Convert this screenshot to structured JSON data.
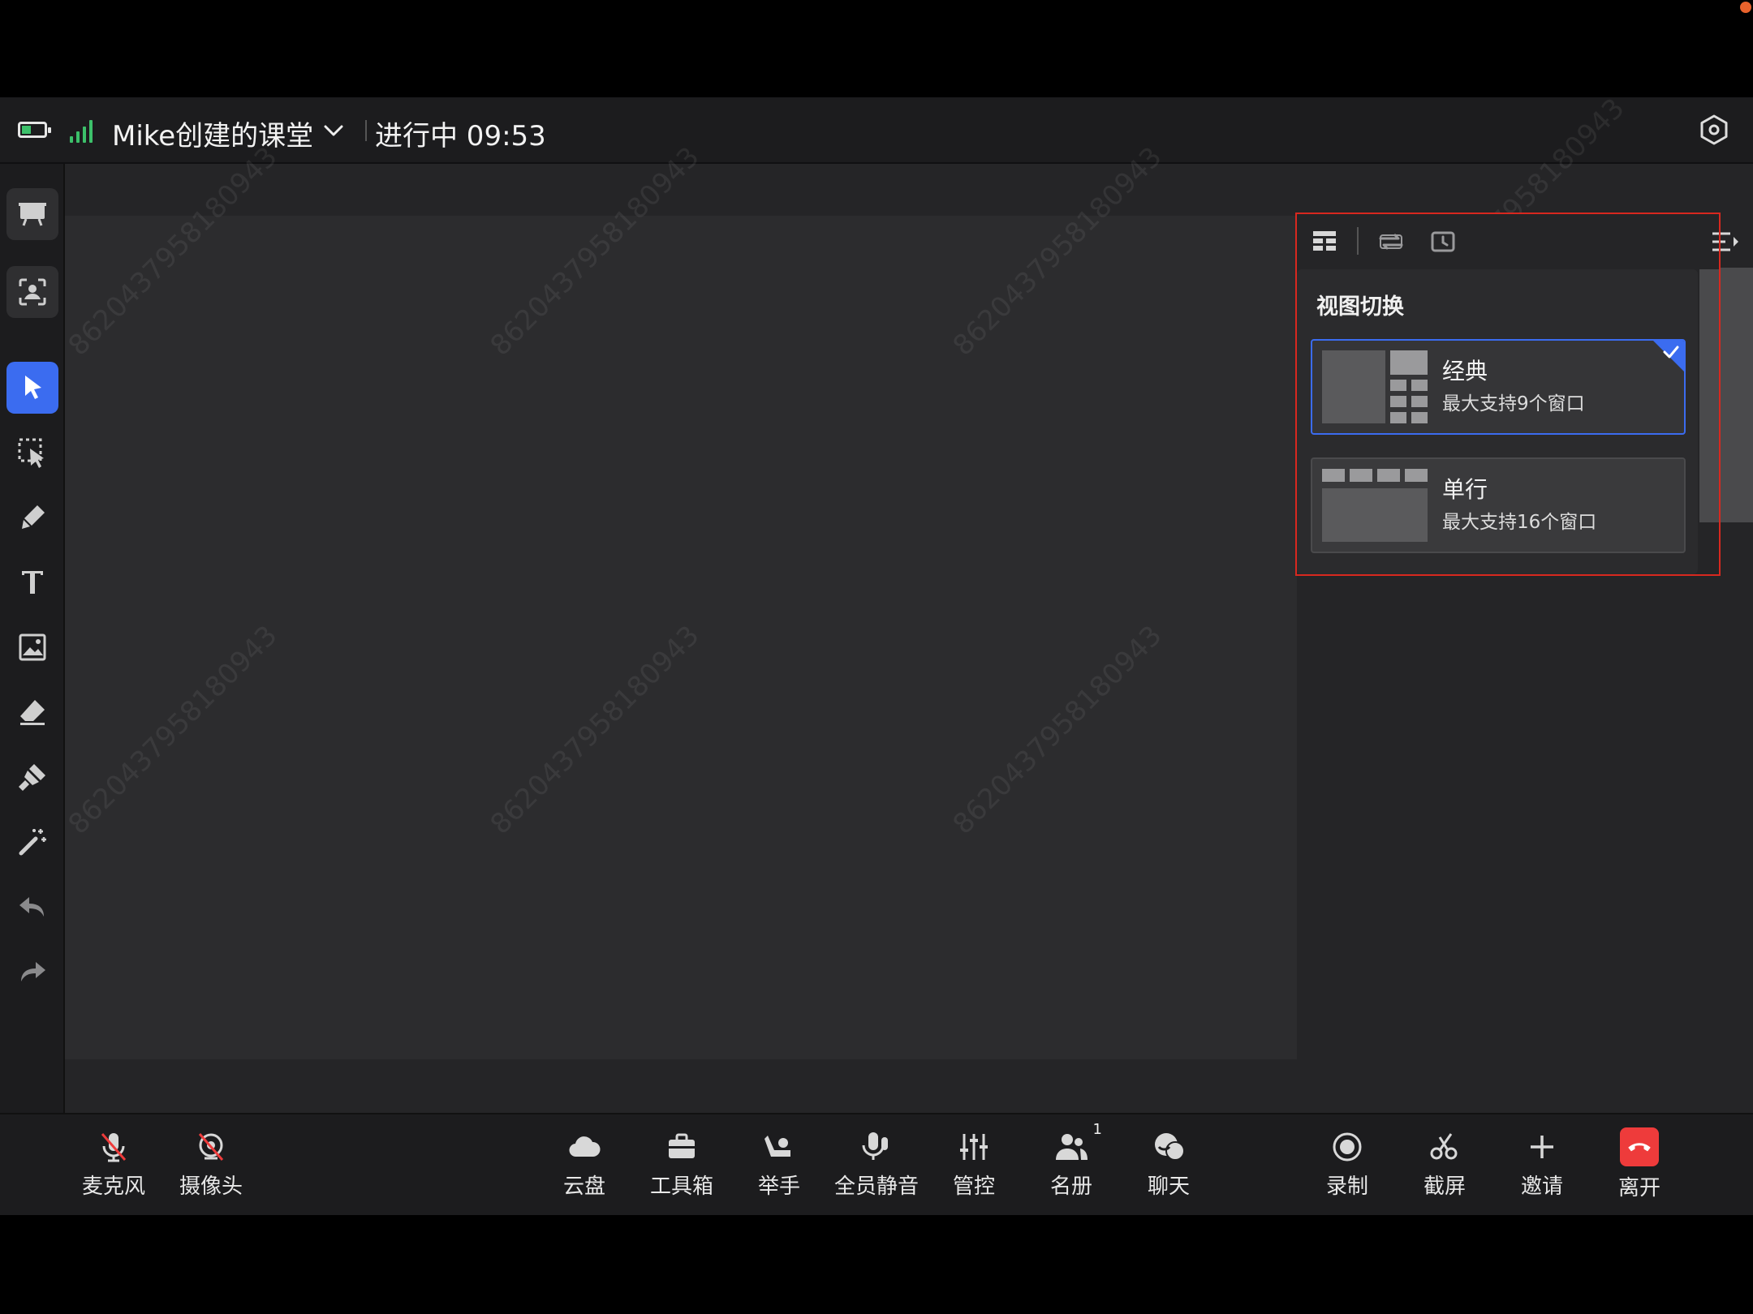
{
  "header": {
    "class_title": "Mike创建的课堂",
    "class_status": "进行中 09:53"
  },
  "watermark": "8620437958180943",
  "view_switch": {
    "title": "视图切换",
    "options": [
      {
        "name": "经典",
        "desc": "最大支持9个窗口",
        "selected": true
      },
      {
        "name": "单行",
        "desc": "最大支持16个窗口",
        "selected": false
      }
    ]
  },
  "left_tools": [
    {
      "icon": "presentation-icon"
    },
    {
      "icon": "face-scan-icon"
    },
    {
      "icon": "pointer-icon",
      "active": true
    },
    {
      "icon": "lasso-select-icon"
    },
    {
      "icon": "pen-icon"
    },
    {
      "icon": "text-icon"
    },
    {
      "icon": "image-icon"
    },
    {
      "icon": "eraser-icon"
    },
    {
      "icon": "brush-icon"
    },
    {
      "icon": "laser-pointer-icon"
    },
    {
      "icon": "undo-icon"
    },
    {
      "icon": "redo-icon"
    }
  ],
  "bottom_bar": {
    "mic": "麦克风",
    "camera": "摄像头",
    "cloud": "云盘",
    "toolbox": "工具箱",
    "raise_hand": "举手",
    "mute_all": "全员静音",
    "manage": "管控",
    "roster": "名册",
    "roster_count": "1",
    "chat": "聊天",
    "record": "录制",
    "screenshot": "截屏",
    "invite": "邀请",
    "leave": "离开"
  },
  "colors": {
    "accent": "#3b6cf0",
    "signal": "#3cc06a",
    "leave": "#ee3b3b",
    "highlight": "#d8281f"
  }
}
